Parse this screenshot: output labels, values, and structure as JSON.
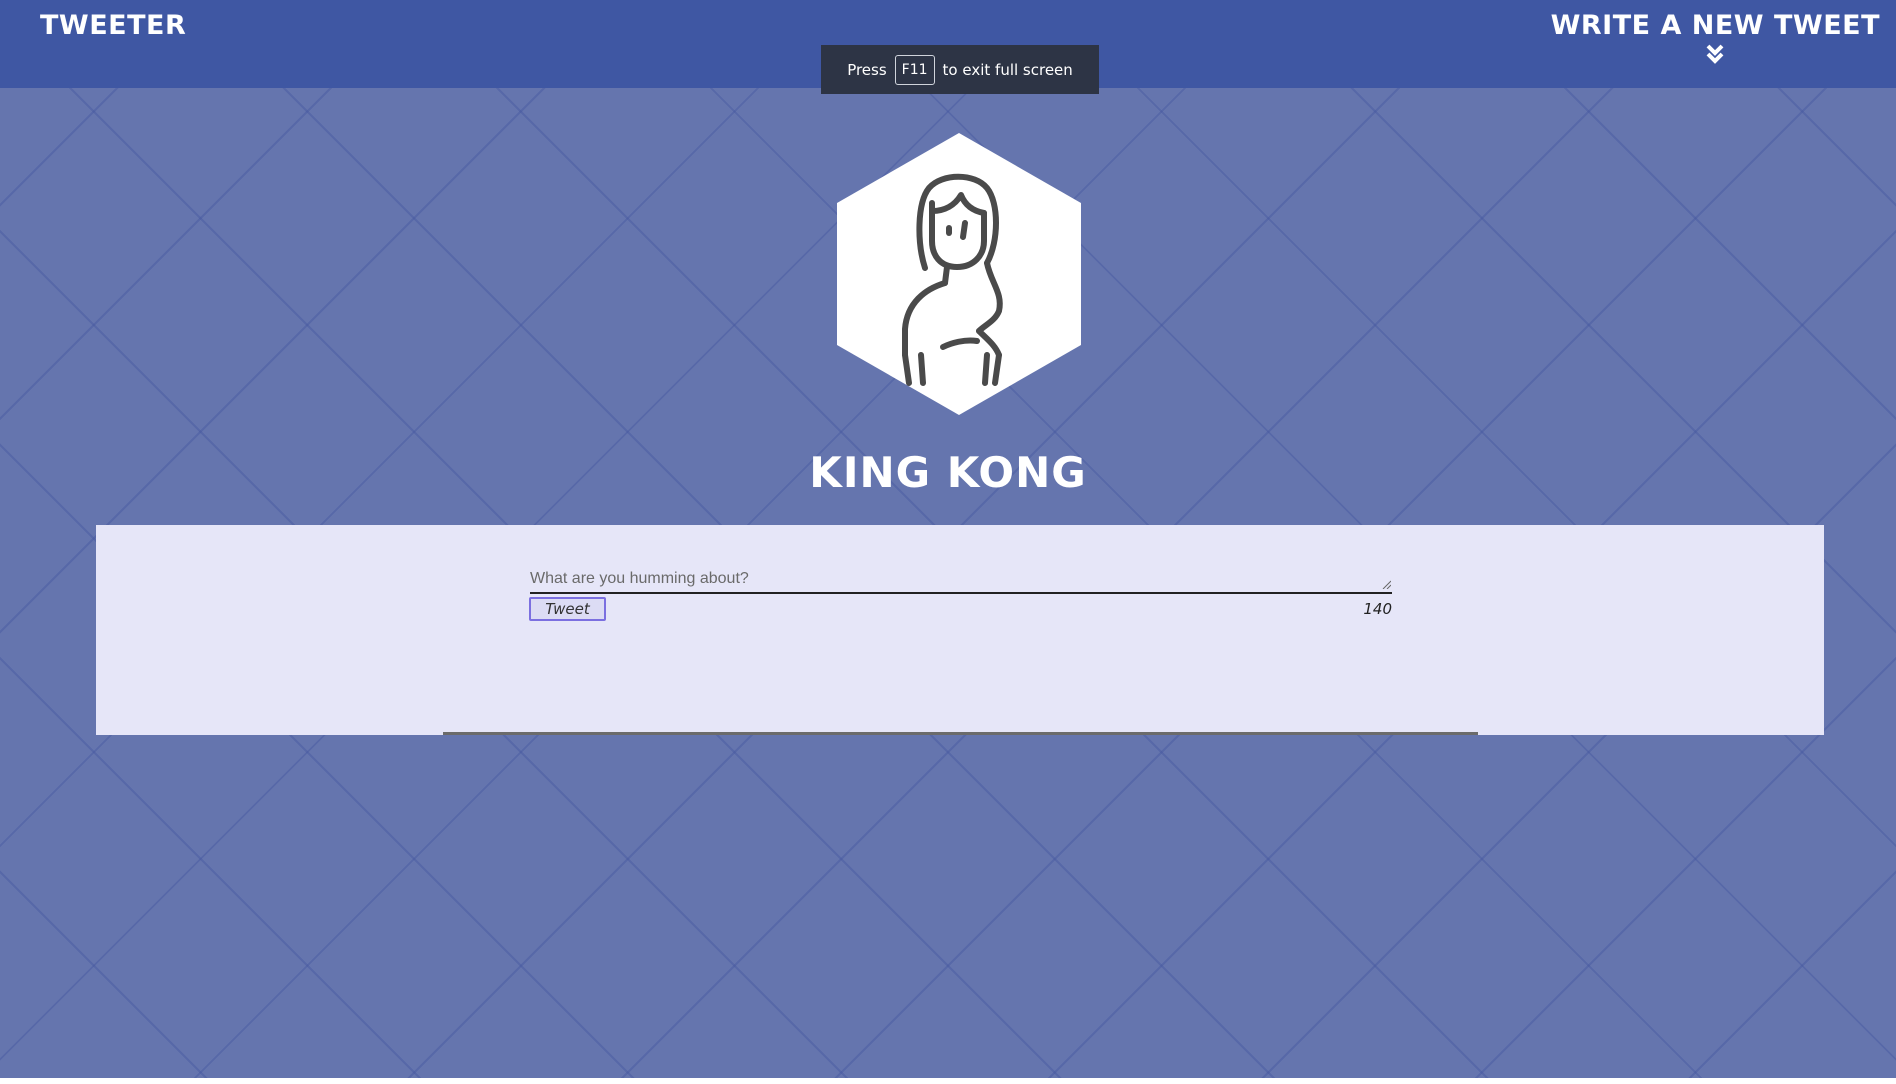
{
  "navbar": {
    "brand": "TWEETER",
    "write_new": "WRITE A NEW TWEET",
    "write_new_icon": "double-chevron-down-icon"
  },
  "fullscreen_notice": {
    "prefix": "Press",
    "key": "F11",
    "suffix": "to exit full screen"
  },
  "profile": {
    "avatar_icon": "person-outline-icon",
    "name": "KING KONG"
  },
  "composer": {
    "placeholder": "What are you humming about?",
    "value": "",
    "button_label": "Tweet",
    "char_remaining": "140"
  },
  "colors": {
    "navbar_bg": "#3f57a3",
    "page_bg": "#6575ae",
    "panel_bg": "#e6e6f8",
    "button_border": "#7b6fe0",
    "avatar_stroke": "#4a4a4a"
  }
}
